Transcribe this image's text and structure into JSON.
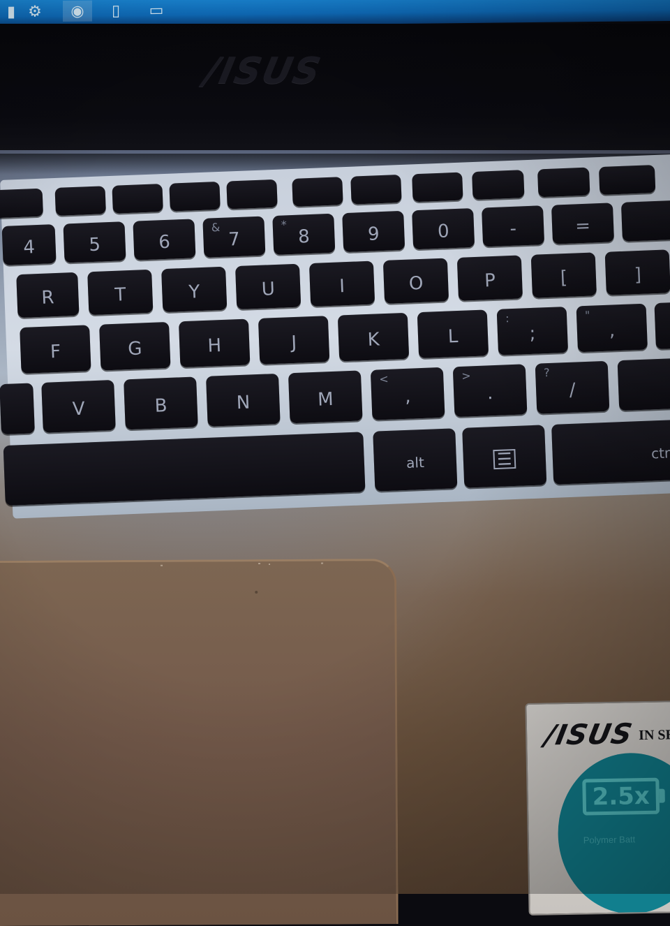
{
  "taskbar": {
    "icons": [
      {
        "name": "app-icon",
        "glyph": "▮"
      },
      {
        "name": "settings-gear-icon",
        "glyph": "⚙"
      },
      {
        "name": "media-player-icon",
        "glyph": "◉"
      },
      {
        "name": "document-icon",
        "glyph": "▯"
      },
      {
        "name": "window-icon",
        "glyph": "▭"
      }
    ]
  },
  "bezel": {
    "brand": "/ISUS"
  },
  "keyboard": {
    "row_function": [
      "",
      "",
      "",
      "",
      "",
      "",
      "",
      "",
      "",
      "",
      ""
    ],
    "row_numbers": [
      {
        "main": "4",
        "sub": ""
      },
      {
        "main": "5",
        "sub": ""
      },
      {
        "main": "6",
        "sub": ""
      },
      {
        "main": "7",
        "sub": "&"
      },
      {
        "main": "8",
        "sub": "*"
      },
      {
        "main": "9",
        "sub": ""
      },
      {
        "main": "0",
        "sub": ""
      },
      {
        "main": "-",
        "sub": ""
      },
      {
        "main": "=",
        "sub": ""
      }
    ],
    "row_top": [
      "R",
      "T",
      "Y",
      "U",
      "I",
      "O",
      "P",
      "[",
      "]"
    ],
    "row_home": [
      {
        "main": "F",
        "sub": ""
      },
      {
        "main": "G",
        "sub": ""
      },
      {
        "main": "H",
        "sub": ""
      },
      {
        "main": "J",
        "sub": ""
      },
      {
        "main": "K",
        "sub": ""
      },
      {
        "main": "L",
        "sub": ""
      },
      {
        "main": ";",
        "sub": ":"
      },
      {
        "main": ",",
        "sub": "\""
      }
    ],
    "row_bottom": [
      {
        "main": "V",
        "sub": ""
      },
      {
        "main": "B",
        "sub": ""
      },
      {
        "main": "N",
        "sub": ""
      },
      {
        "main": "M",
        "sub": ""
      },
      {
        "main": ",",
        "sub": "<"
      },
      {
        "main": ".",
        "sub": ">"
      },
      {
        "main": "/",
        "sub": "?"
      }
    ],
    "row_space": {
      "space": "",
      "alt": "alt",
      "menu": "☰",
      "ctrl": "ctrl"
    }
  },
  "sticker": {
    "brand": "/ISUS",
    "tag": "IN SE",
    "battery_label": "2.5x",
    "caption": "Polymer Batt"
  },
  "colors": {
    "key_body": "#111017",
    "key_legend": "#9fa6b8",
    "deck_backlight": "#c8d0dc",
    "palm_rest": "#73594a",
    "sticker_teal": "#117f8e"
  }
}
